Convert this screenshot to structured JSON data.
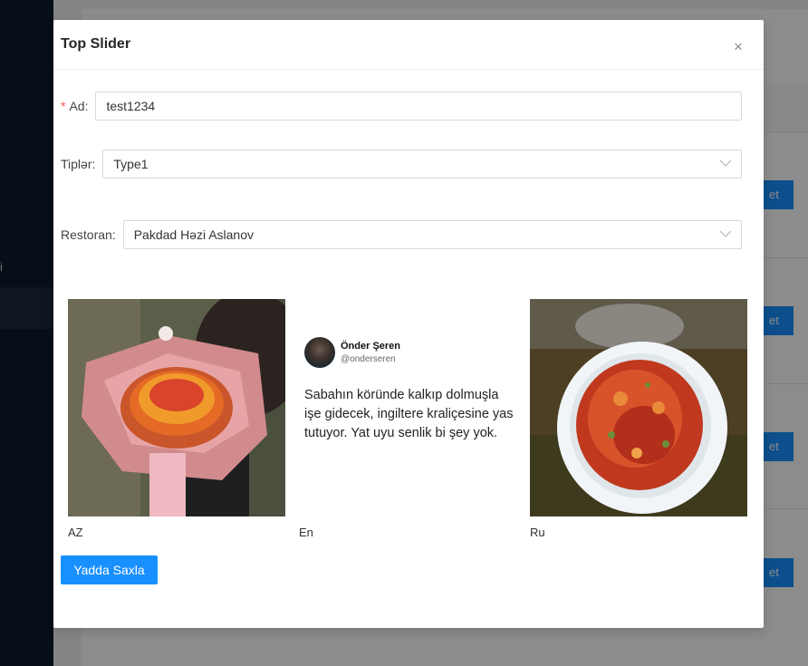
{
  "modal": {
    "title": "Top Slider",
    "close_symbol": "×",
    "fields": {
      "name": {
        "label": "Ad",
        "colon": ":",
        "required_mark": "*",
        "value": "test1234"
      },
      "types": {
        "label": "Tiplər",
        "colon": ":",
        "value": "Type1"
      },
      "restaurant": {
        "label": "Restoran",
        "colon": ":",
        "value": "Pakdad Həzi Aslanov"
      }
    },
    "images": [
      {
        "caption": "AZ",
        "icon": "flower-bouquet-photo"
      },
      {
        "caption": "En",
        "icon": "tweet-screenshot",
        "tweet": {
          "name": "Önder Şeren",
          "handle": "@onderseren",
          "text": "Sabahın köründe kalkıp dolmuşla işe gidecek, ingiltere kraliçesine yas tutuyor. Yat uyu senlik bi şey yok."
        }
      },
      {
        "caption": "Ru",
        "icon": "food-plate-photo"
      }
    ],
    "save_label": "Yadda Saxla"
  },
  "background": {
    "sidebar_text": "i",
    "action_label": "et"
  },
  "colors": {
    "primary": "#1890ff",
    "required": "#ff4d4f",
    "sidebar": "#0c1b2a"
  }
}
